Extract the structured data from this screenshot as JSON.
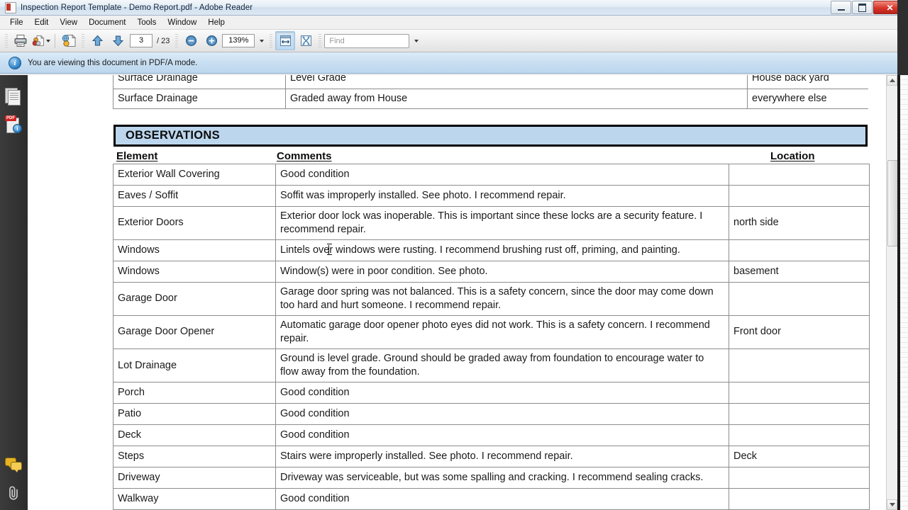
{
  "window": {
    "title": "Inspection Report Template - Demo Report.pdf - Adobe Reader",
    "app_icon": "adobe-reader-icon",
    "minimize_label": "Minimize",
    "maximize_label": "Restore",
    "close_label": "Close"
  },
  "menubar": {
    "items": [
      {
        "label": "File"
      },
      {
        "label": "Edit"
      },
      {
        "label": "View"
      },
      {
        "label": "Document"
      },
      {
        "label": "Tools"
      },
      {
        "label": "Window"
      },
      {
        "label": "Help"
      }
    ]
  },
  "toolbar": {
    "print_icon": "printer-icon",
    "email_icon": "share-file-icon",
    "email_caret": "chevron-down-icon",
    "collaborate_icon": "globe-document-icon",
    "prev_page_icon": "arrow-up-icon",
    "next_page_icon": "arrow-down-icon",
    "current_page": "3",
    "page_separator": "/ 23",
    "total_pages": "23",
    "zoom_out_icon": "zoom-out-icon",
    "zoom_in_icon": "zoom-in-icon",
    "zoom_value": "139%",
    "zoom_caret": "chevron-down-icon",
    "fit_width_icon": "fit-width-icon",
    "fit_page_icon": "fit-page-icon",
    "find_placeholder": "Find",
    "find_value": "",
    "find_caret": "chevron-down-icon"
  },
  "notification": {
    "icon": "info-icon",
    "glyph": "i",
    "text": "You are viewing this document in PDF/A mode."
  },
  "navpane": {
    "items": [
      {
        "name": "pages-panel",
        "icon": "pages-thumbnail-icon",
        "label": "Page Thumbnails"
      },
      {
        "name": "standards-panel",
        "icon": "pdfa-standards-icon",
        "label": "Standards"
      },
      {
        "name": "comments-panel",
        "icon": "comments-icon",
        "label": "Comments"
      },
      {
        "name": "attachments-panel",
        "icon": "paperclip-icon",
        "label": "Attachments"
      }
    ]
  },
  "scrollbar": {
    "up_arrow": "scroll-up-arrow",
    "down_arrow": "scroll-down-arrow",
    "thumb": "scroll-thumb"
  },
  "document": {
    "top_table": {
      "rows": [
        {
          "element": "Surface Drainage",
          "comments": "Level Grade",
          "location": "House back yard"
        },
        {
          "element": "Surface Drainage",
          "comments": "Graded away from House",
          "location": "everywhere else"
        }
      ]
    },
    "section_banner": "OBSERVATIONS",
    "headers": {
      "element": "Element",
      "comments": "Comments",
      "location": "Location"
    },
    "rows": [
      {
        "element": "Exterior Wall Covering",
        "comments": "Good condition",
        "location": ""
      },
      {
        "element": "Eaves / Soffit",
        "comments": "Soffit was improperly installed. See photo. I recommend repair.",
        "location": ""
      },
      {
        "element": "Exterior Doors",
        "comments": "Exterior door lock was inoperable. This is important since these locks are a security feature. I recommend repair.",
        "location": "north side"
      },
      {
        "element": "Windows",
        "comments": "Lintels over windows were rusting.  I recommend brushing rust off, priming, and painting.",
        "location": ""
      },
      {
        "element": "Windows",
        "comments": "Window(s) were in poor condition.  See photo.",
        "location": "basement"
      },
      {
        "element": "Garage Door",
        "comments": "Garage door spring was not balanced.  This is a safety concern, since the door may come down too hard and hurt someone. I recommend repair.",
        "location": ""
      },
      {
        "element": "Garage Door Opener",
        "comments": "Automatic garage door opener photo eyes did not work.  This is a safety concern.  I recommend repair.",
        "location": "Front door"
      },
      {
        "element": "Lot Drainage",
        "comments": "Ground is level grade.  Ground should be graded away from foundation to encourage water to flow away from the foundation.",
        "location": ""
      },
      {
        "element": "Porch",
        "comments": "Good condition",
        "location": ""
      },
      {
        "element": "Patio",
        "comments": "Good condition",
        "location": ""
      },
      {
        "element": "Deck",
        "comments": "Good condition",
        "location": ""
      },
      {
        "element": "Steps",
        "comments": "Stairs were improperly installed.  See photo. I recommend repair.",
        "location": "Deck"
      },
      {
        "element": "Driveway",
        "comments": "Driveway was serviceable, but was some spalling and cracking.  I recommend sealing cracks.",
        "location": ""
      },
      {
        "element": "Walkway",
        "comments": "Good condition",
        "location": ""
      }
    ]
  },
  "colors": {
    "banner_fill": "#bcd6ee",
    "notification_bar": "#c9dff2",
    "titlebar": "#dce8f3",
    "close_button": "#d8352a",
    "navpane": "#333333",
    "page": "#ffffff",
    "table_border": "#8d8d8d"
  }
}
